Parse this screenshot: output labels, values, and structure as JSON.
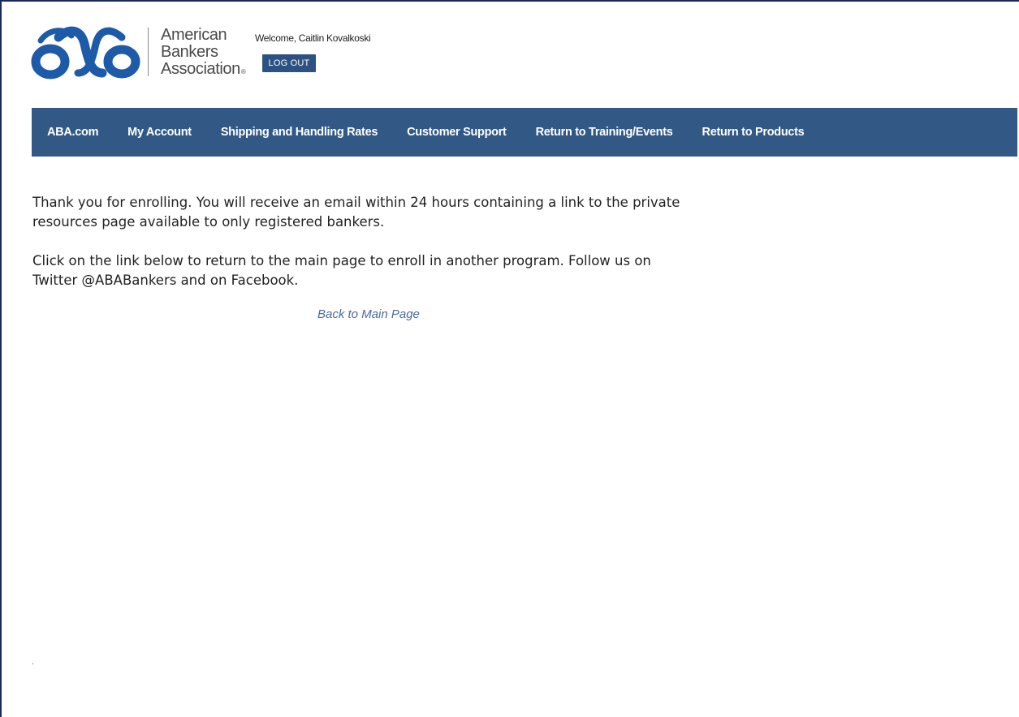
{
  "header": {
    "logo_line1": "American",
    "logo_line2": "Bankers",
    "logo_line3": "Association",
    "logo_reg": "®",
    "welcome": "Welcome, Caitlin Kovalkoski",
    "logout_label": "LOG OUT"
  },
  "nav": {
    "items": [
      {
        "label": "ABA.com"
      },
      {
        "label": "My Account"
      },
      {
        "label": "Shipping and Handling Rates"
      },
      {
        "label": "Customer Support"
      },
      {
        "label": "Return to Training/Events"
      },
      {
        "label": "Return to Products"
      }
    ]
  },
  "main": {
    "paragraph1": "Thank you for enrolling. You will receive an email within 24 hours containing a link to the private resources page available to only registered bankers.",
    "paragraph2": "Click on the link below to return to the main page to enroll in another program.  Follow us on Twitter @ABABankers and on Facebook.",
    "back_link": "Back to Main Page"
  },
  "colors": {
    "brand_blue": "#1d5aa8",
    "nav_background": "#325885",
    "logout_background": "#2d5182",
    "link": "#4a6aa0"
  }
}
